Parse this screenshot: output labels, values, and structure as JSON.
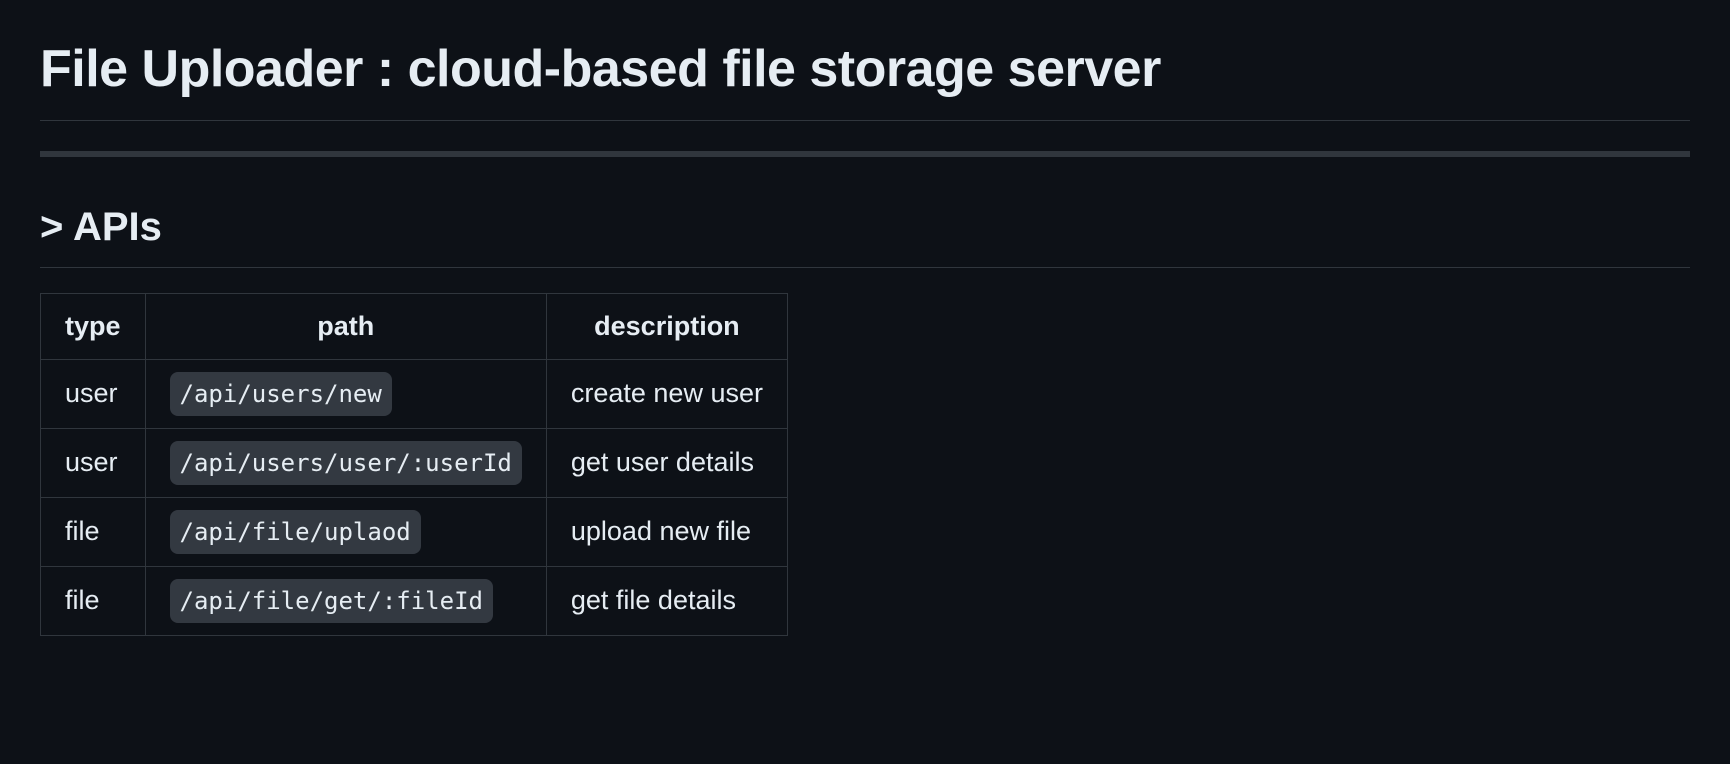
{
  "title": "File Uploader : cloud-based file storage server",
  "section_heading": "> APIs",
  "table": {
    "headers": {
      "type": "type",
      "path": "path",
      "description": "description"
    },
    "rows": [
      {
        "type": "user",
        "path": "/api/users/new",
        "description": "create new user"
      },
      {
        "type": "user",
        "path": "/api/users/user/:userId",
        "description": "get user details"
      },
      {
        "type": "file",
        "path": "/api/file/uplaod",
        "description": "upload new file"
      },
      {
        "type": "file",
        "path": "/api/file/get/:fileId",
        "description": "get file details"
      }
    ]
  }
}
